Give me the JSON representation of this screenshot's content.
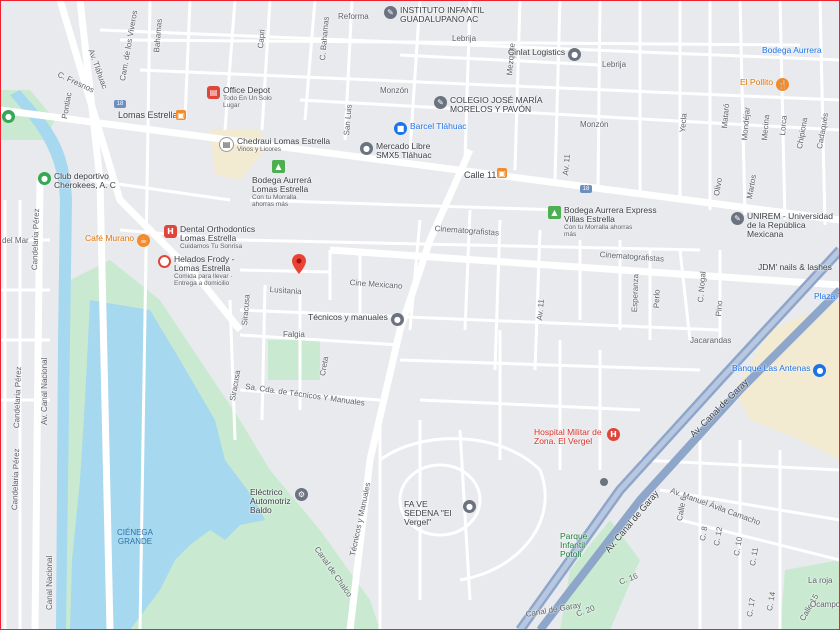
{
  "map": {
    "colors": {
      "background": "#e9eaee",
      "road": "#ffffff",
      "major_road": "#ffffff",
      "expressway": "#8ea6c9",
      "park": "#c9ead1",
      "water": "#a6d8f0",
      "sand": "#f3ead2",
      "pin": "#ea4335"
    },
    "streets": {
      "reforma": "Reforma",
      "lebrija_1": "Lebrija",
      "lebrija_2": "Lebrija",
      "monzon_1": "Monzón",
      "monzon_2": "Monzón",
      "lomas_estrella": "Lomas Estrella",
      "calle_11": "Calle 11",
      "av_11": "Av. 11",
      "av_11_b": "Av. 11",
      "cinematografistas_1": "Cinematografistas",
      "cinematografistas_2": "Cinematografistas",
      "cine_mexicano": "Cine Mexicano",
      "lusitania": "Lusitania",
      "falgia": "Falgia",
      "creta": "Creta",
      "siracusa_1": "Siracusa",
      "siracusa_2": "Siracusa",
      "tecnicos_manuales": "Técnicos y manuales",
      "tecnicos_manuales_2": "Técnicos y Manuales",
      "sa_cda": "Sa. Cda. de Técnicos Y Manuales",
      "jacarandas": "Jacarandas",
      "canal_chalco": "Canal de Chalco",
      "canal_garay_1": "Av. Canal de Garay",
      "canal_garay_2": "Av. Canal de Garay",
      "canal_garay_3": "Canal de Garay",
      "avila_camacho": "Av. Manuel Ávila Camacho",
      "canal_nacional_1": "Av. Canal Nacional",
      "canal_nacional_2": "Canal Nacional",
      "candelaria_1": "Candelaria Pérez",
      "candelaria_2": "Candelaria Pérez",
      "candelaria_3": "Candelaria Pérez",
      "del_mar": "del Mar",
      "av_tlahuac": "Av. Tláhuac",
      "cam_viveros": "Cam. de los Viveros",
      "bahamas": "Bahamas",
      "c_bahamas": "C. Bahamas",
      "capri": "Capri",
      "c_fresnos": "C. Fresnos",
      "pontiac": "Pontiac",
      "san_luis": "San Luis",
      "esperanza": "Esperanza",
      "perlo": "Perlo",
      "c_nogal": "C. Nogal",
      "pino": "Pino",
      "mezquite": "Mezquite",
      "yecla": "Yecla",
      "olivo": "Olivo",
      "mataro": "Mataró",
      "martos": "Martos",
      "mondejar": "Mondéjar",
      "mecina": "Mecina",
      "lorca": "Lorca",
      "chipiona": "Chipiona",
      "cadaques": "Cadaqués",
      "c10": "C. 10",
      "c11": "C. 11",
      "c12": "C. 12",
      "c14": "C. 14",
      "c16": "C. 16",
      "c17": "C. 17",
      "c20": "C. 20",
      "calle6": "Calle 6",
      "calle15": "Calle 15",
      "c8": "C. 8",
      "ocampo": "Ocampo",
      "la_roja": "La roja"
    },
    "shields": {
      "s1": "18",
      "s2": "18"
    },
    "lake": {
      "name": "CIÉNEGA GRANDE"
    },
    "pois": {
      "infantil": {
        "name": "INSTITUTO INFANTIL GUADALUPANO AC",
        "icon": "school-icon"
      },
      "cinlat": {
        "name": "Cinlat Logistics",
        "icon": "business-icon"
      },
      "bodega_top": {
        "name": "Bodega Aurrera",
        "icon": "store-icon"
      },
      "pollito": {
        "name": "El Pollito",
        "icon": "restaurant-icon"
      },
      "office_depot": {
        "name": "Office Depot",
        "sub": "Todo En Un Solo Lugar",
        "icon": "store-icon"
      },
      "colegio": {
        "name": "COLEGIO JOSÉ MARÍA MORELOS Y PAVÓN",
        "icon": "school-icon"
      },
      "barcel": {
        "name": "Barcel Tláhuac",
        "icon": "shopping-icon"
      },
      "mercado": {
        "name": "Mercado Libre SMX5 Tláhuac",
        "icon": "business-icon"
      },
      "chedraui": {
        "name": "Chedraui Lomas Estrella",
        "sub": "Vinos y Licores",
        "icon": "store-icon"
      },
      "bodega_le": {
        "name": "Bodega Aurrerá Lomas Estrella",
        "sub": "Con tu Morralla ahorras más",
        "icon": "store-icon"
      },
      "bodega_ve": {
        "name": "Bodega Aurrera Express Villas Estrella",
        "sub": "Con tu Morralla ahorras más",
        "icon": "store-icon"
      },
      "unirem": {
        "name": "UNIREM - Universidad de la República Mexicana",
        "icon": "school-icon"
      },
      "club": {
        "name": "Club deportivo Cherokees, A. C",
        "icon": "park-icon"
      },
      "dental": {
        "name": "Dental Orthodontics Lomas Estrella",
        "sub": "Cuidamos Tu Sonrisa",
        "icon": "hospital-icon"
      },
      "cafe": {
        "name": "Café Murano",
        "icon": "cafe-icon"
      },
      "helados": {
        "name": "Helados Frody - Lomas Estrella",
        "sub": "Comida para llevar · Entrega a domicilio",
        "icon": "ice-cream-icon"
      },
      "tecnicos": {
        "name": "Técnicos y manuales",
        "icon": "place-icon"
      },
      "jdm": {
        "name": "JDM' nails & lashes",
        "icon": "beauty-icon"
      },
      "plaza": {
        "name": "Plaza T",
        "icon": "shopping-icon"
      },
      "banque": {
        "name": "Banque Las Antenas",
        "icon": "park-icon"
      },
      "hospital": {
        "name": "Hospital Militar de Zona. El Vergel",
        "icon": "hospital-icon"
      },
      "electrico": {
        "name": "Eléctrico Automotriz Baldo",
        "icon": "repair-icon"
      },
      "fa_ve": {
        "name": "FA VE SEDENA \"El Vergel\"",
        "icon": "place-icon"
      },
      "parque": {
        "name": "Parque Infantil Potoli",
        "icon": "park-icon"
      }
    }
  }
}
